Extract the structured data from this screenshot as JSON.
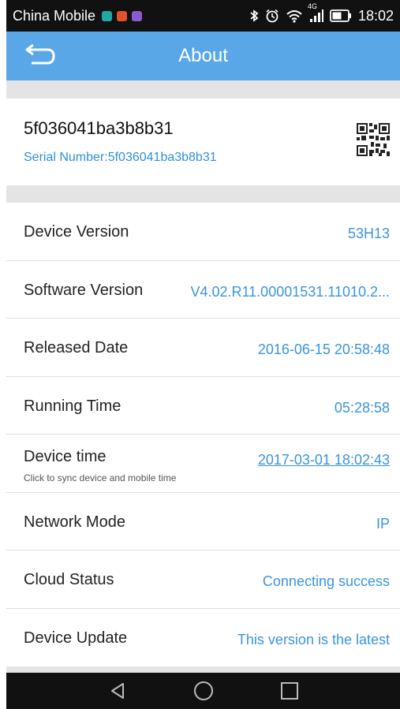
{
  "status_bar": {
    "carrier": "China Mobile",
    "network_label": "4G",
    "time": "18:02",
    "icons": [
      "app-icon-teal",
      "app-icon-red",
      "app-icon-purple",
      "bluetooth-icon",
      "alarm-icon",
      "wifi-icon",
      "signal-icon",
      "battery-icon"
    ]
  },
  "header": {
    "title": "About",
    "back_icon": "back-icon"
  },
  "device": {
    "name": "5f036041ba3b8b31",
    "serial": "Serial Number:5f036041ba3b8b31",
    "qr_icon": "qr-code-icon"
  },
  "info": [
    {
      "label": "Device Version",
      "value": "53H13"
    },
    {
      "label": "Software Version",
      "value": "V4.02.R11.00001531.11010.2..."
    },
    {
      "label": "Released Date",
      "value": "2016-06-15 20:58:48"
    },
    {
      "label": "Running Time",
      "value": "05:28:58"
    },
    {
      "label": "Device time",
      "hint": "Click to sync device and mobile time",
      "value": "2017-03-01 18:02:43"
    },
    {
      "label": "Network Mode",
      "value": "IP"
    },
    {
      "label": "Cloud Status",
      "value": "Connecting success"
    },
    {
      "label": "Device Update",
      "value": "This version is the latest"
    }
  ],
  "nav_bar": {
    "icons": [
      "nav-back-icon",
      "nav-home-icon",
      "nav-recents-icon"
    ]
  },
  "colors": {
    "header": "#5aa7e8",
    "value_text": "#3b94dc",
    "separator": "#e4e4e4"
  }
}
